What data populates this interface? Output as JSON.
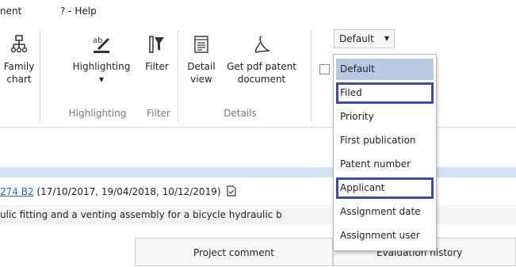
{
  "menu": {
    "item1": "nent",
    "item2": "? - Help"
  },
  "ribbon": {
    "family_chart": {
      "line1": "Family",
      "line2": "chart"
    },
    "highlighting": {
      "label": "Highlighting",
      "arrow": "▾"
    },
    "filter": {
      "label": "Filter"
    },
    "detail_view": {
      "line1": "Detail",
      "line2": "view"
    },
    "get_pdf": {
      "line1": "Get pdf patent",
      "line2": "document"
    },
    "groups": {
      "highlighting": "Highlighting",
      "filter": "Filter",
      "details": "Details"
    },
    "icons": [
      "family-chart-icon",
      "highlighter-icon",
      "filter-icon",
      "detail-view-icon",
      "pdf-icon"
    ]
  },
  "sort_select": {
    "value": "Default",
    "options": [
      "Default",
      "Filed",
      "Priority",
      "First publication",
      "Patent number",
      "Applicant",
      "Assignment date",
      "Assignment user"
    ],
    "selected_index": 0,
    "highlighted": [
      "Filed",
      "Applicant"
    ]
  },
  "patent": {
    "number_fragment": "274 B2",
    "dates": " (17/10/2017, 19/04/2018, 10/12/2019)",
    "description": "ulic fitting and a venting assembly for a bicycle hydraulic b"
  },
  "tabs": {
    "project_comment": "Project comment",
    "evaluation_history": "Evaluation history"
  },
  "colors": {
    "selection": "#b8c9e3",
    "highlight_box": "#3b4bb3",
    "link": "#1f6fbf",
    "band": "#d0e2f2"
  }
}
